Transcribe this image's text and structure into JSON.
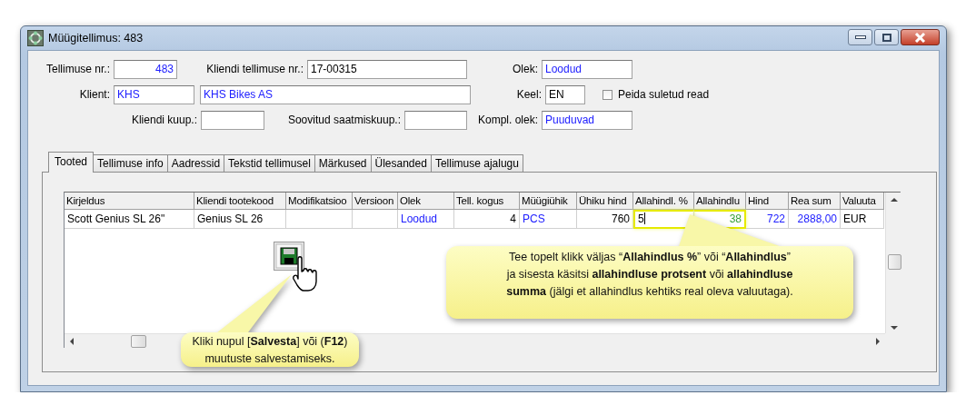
{
  "window": {
    "title": "Müügitellimus: 483"
  },
  "form_rows": [
    {
      "items": [
        {
          "kind": "field",
          "label": "Tellimuse nr.:",
          "fields": [
            {
              "value": "483",
              "lookup": true,
              "numeric": true
            }
          ]
        },
        {
          "kind": "field",
          "label": "Kliendi tellimuse nr.:",
          "fields": [
            {
              "value": "17-00315",
              "lookup": false,
              "numeric": false
            }
          ]
        },
        {
          "kind": "field",
          "label": "Olek:",
          "fields": [
            {
              "value": "Loodud",
              "lookup": true,
              "numeric": false
            }
          ]
        }
      ]
    },
    {
      "items": [
        {
          "kind": "field",
          "label": "Klient:",
          "fields": [
            {
              "value": "KHS",
              "lookup": true,
              "numeric": false
            },
            {
              "value": "KHS Bikes AS",
              "lookup": true,
              "numeric": false
            }
          ]
        },
        {
          "kind": "field",
          "label": "Keel:",
          "fields": [
            {
              "value": "EN",
              "lookup": false,
              "numeric": false
            }
          ]
        },
        {
          "kind": "checkbox",
          "label": "Peida suletud read",
          "checked": false
        }
      ]
    },
    {
      "items": [
        {
          "kind": "field",
          "label": "Kliendi kuup.:"
        },
        {
          "kind": "field",
          "label": "Soovitud saatmiskuup.:"
        },
        {
          "kind": "field",
          "label": "Kompl. olek:",
          "fields": [
            {
              "value": "Puuduvad",
              "lookup": true,
              "numeric": false
            }
          ]
        }
      ]
    }
  ],
  "tabs": [
    {
      "label": "Tooted",
      "selected": true
    },
    {
      "label": "Tellimuse info",
      "selected": false
    },
    {
      "label": "Aadressid",
      "selected": false
    },
    {
      "label": "Tekstid tellimusel",
      "selected": false
    },
    {
      "label": "Märkused",
      "selected": false
    },
    {
      "label": "Ülesanded",
      "selected": false
    },
    {
      "label": "Tellimuse ajalugu",
      "selected": false
    }
  ],
  "table": {
    "columns": [
      {
        "label": "Kirjeldus",
        "numeric": false
      },
      {
        "label": "Kliendi tootekood",
        "numeric": false
      },
      {
        "label": "Modifikatsioo"
      },
      {
        "label": "Versioon"
      },
      {
        "label": "Olek",
        "numeric": false
      },
      {
        "label": "Tell. kogus",
        "numeric": true
      },
      {
        "label": "Müügiühik",
        "numeric": false
      },
      {
        "label": "Ühiku hind",
        "numeric": true
      },
      {
        "label": "Allahindl. %",
        "numeric": false
      },
      {
        "label": "Allahindlu",
        "numeric": true
      },
      {
        "label": "Hind",
        "numeric": true
      },
      {
        "label": "Rea sum",
        "numeric": true
      },
      {
        "label": "Valuuta",
        "numeric": false
      }
    ],
    "rows": [
      {
        "cells": [
          {
            "text": "Scott Genius SL 26\"",
            "kind": "plain",
            "highlighted": false,
            "editing": false
          },
          {
            "text": "Genius SL 26",
            "kind": "plain",
            "highlighted": false,
            "editing": false
          },
          {
            "kind": "plain",
            "highlighted": false,
            "editing": false
          },
          {
            "kind": "plain",
            "highlighted": false,
            "editing": false
          },
          {
            "text": "Loodud",
            "kind": "lookup",
            "highlighted": false,
            "editing": false
          },
          {
            "text": "4",
            "kind": "plain",
            "highlighted": false,
            "editing": false
          },
          {
            "text": "PCS",
            "kind": "lookup",
            "highlighted": false,
            "editing": false
          },
          {
            "text": "760",
            "kind": "plain",
            "highlighted": false,
            "editing": false
          },
          {
            "text": "5",
            "kind": "plain",
            "highlighted": true,
            "editing": true
          },
          {
            "text": "38",
            "kind": "computed",
            "highlighted": true,
            "editing": false
          },
          {
            "text": "722",
            "kind": "lookup",
            "highlighted": false,
            "editing": false
          },
          {
            "text": "2888,00",
            "kind": "lookup",
            "highlighted": false,
            "editing": false
          },
          {
            "text": "EUR",
            "kind": "plain",
            "highlighted": false,
            "editing": false
          }
        ]
      }
    ]
  },
  "callouts": [
    {
      "kind": "save",
      "text": "Kliki nupul [**Salvesta**] või (**F12**)\nmuutuste salvestamiseks."
    },
    {
      "kind": "discount",
      "text": "Tee topelt klikk väljas “**Allahindlus %**” või “**Allahindlus**”\nja sisesta käsitsi **allahindluse protsent** või **allahindluse**\n**summa** (jälgi et allahindlus kehtiks real oleva valuutaga)."
    }
  ]
}
